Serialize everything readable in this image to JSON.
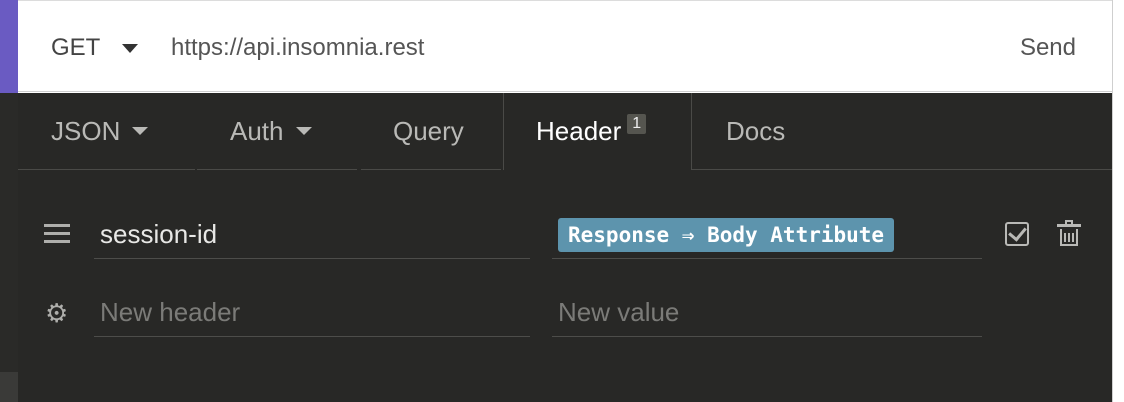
{
  "request": {
    "method": "GET",
    "url": "https://api.insomnia.rest",
    "send_label": "Send"
  },
  "tabs": [
    {
      "label": "JSON",
      "has_dropdown": true
    },
    {
      "label": "Auth",
      "has_dropdown": true
    },
    {
      "label": "Query",
      "has_dropdown": false
    },
    {
      "label": "Header",
      "badge": "1",
      "active": true
    },
    {
      "label": "Docs",
      "has_dropdown": false
    }
  ],
  "headers": [
    {
      "name": "session-id",
      "value_tag": "Response ⇒ Body Attribute",
      "enabled": true
    }
  ],
  "new_row": {
    "name_placeholder": "New header",
    "value_placeholder": "New value"
  },
  "colors": {
    "accent": "#6a5bc2",
    "panel_bg": "#282826",
    "tag_bg": "#5d94ad"
  }
}
